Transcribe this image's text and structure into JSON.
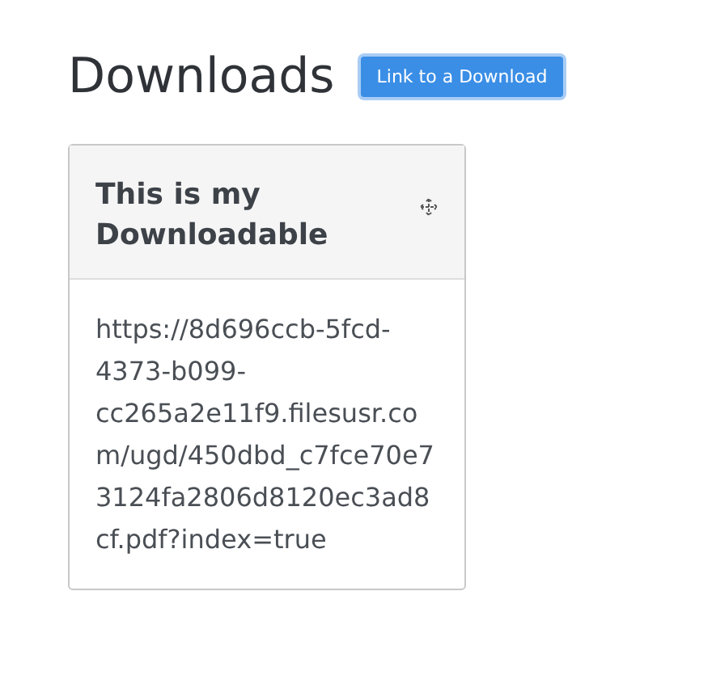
{
  "heading": "Downloads",
  "link_button": {
    "label": "Link to a Download"
  },
  "card": {
    "title": "This is my Downloadable",
    "url": "https://8d696ccb-5fcd-4373-b099-cc265a2e11f9.filesusr.com/ugd/450dbd_c7fce70e73124fa2806d8120ec3ad8cf.pdf?index=true"
  }
}
